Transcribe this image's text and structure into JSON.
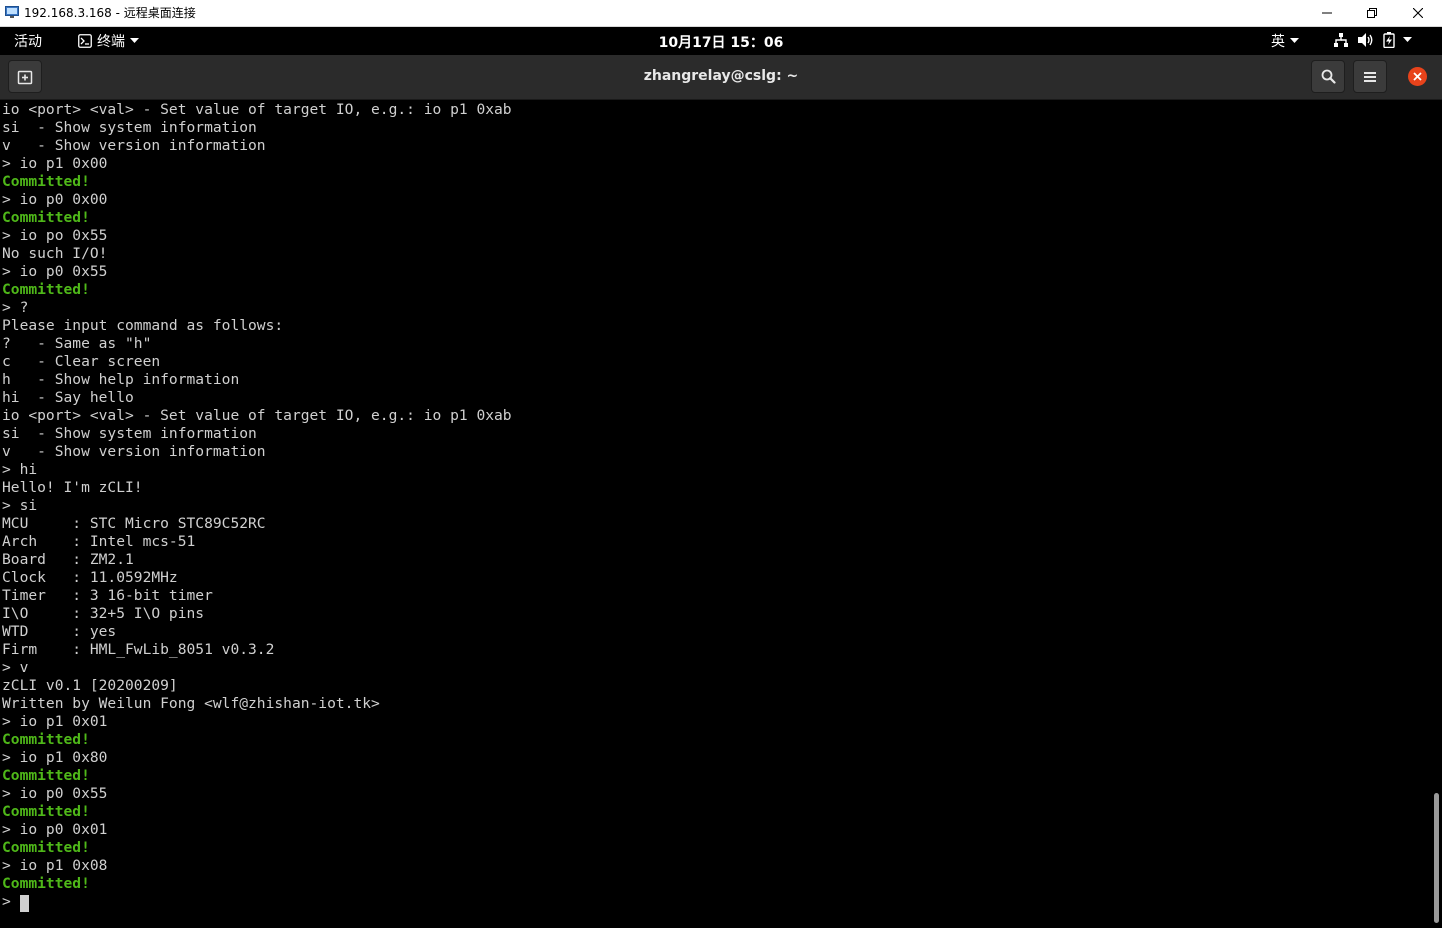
{
  "rdp": {
    "title": "192.168.3.168 - 远程桌面连接"
  },
  "gnome": {
    "activities": "活动",
    "app_name": "终端",
    "clock": "10月17日 15：06",
    "input_method": "英"
  },
  "terminal": {
    "title": "zhangrelay@cslg: ~",
    "prompt": "> ",
    "lines": [
      {
        "text": "io <port> <val> - Set value of target IO, e.g.: io p1 0xab",
        "ok": false
      },
      {
        "text": "si  - Show system information",
        "ok": false
      },
      {
        "text": "v   - Show version information",
        "ok": false
      },
      {
        "text": "> io p1 0x00",
        "ok": false
      },
      {
        "text": "Committed!",
        "ok": true
      },
      {
        "text": "> io p0 0x00",
        "ok": false
      },
      {
        "text": "Committed!",
        "ok": true
      },
      {
        "text": "> io po 0x55",
        "ok": false
      },
      {
        "text": "No such I/O!",
        "ok": false
      },
      {
        "text": "> io p0 0x55",
        "ok": false
      },
      {
        "text": "Committed!",
        "ok": true
      },
      {
        "text": "> ?",
        "ok": false
      },
      {
        "text": "Please input command as follows:",
        "ok": false
      },
      {
        "text": "?   - Same as \"h\"",
        "ok": false
      },
      {
        "text": "c   - Clear screen",
        "ok": false
      },
      {
        "text": "h   - Show help information",
        "ok": false
      },
      {
        "text": "hi  - Say hello",
        "ok": false
      },
      {
        "text": "io <port> <val> - Set value of target IO, e.g.: io p1 0xab",
        "ok": false
      },
      {
        "text": "si  - Show system information",
        "ok": false
      },
      {
        "text": "v   - Show version information",
        "ok": false
      },
      {
        "text": "> hi",
        "ok": false
      },
      {
        "text": "Hello! I'm zCLI!",
        "ok": false
      },
      {
        "text": "> si",
        "ok": false
      },
      {
        "text": "MCU     : STC Micro STC89C52RC",
        "ok": false
      },
      {
        "text": "Arch    : Intel mcs-51",
        "ok": false
      },
      {
        "text": "Board   : ZM2.1",
        "ok": false
      },
      {
        "text": "Clock   : 11.0592MHz",
        "ok": false
      },
      {
        "text": "Timer   : 3 16-bit timer",
        "ok": false
      },
      {
        "text": "I\\O     : 32+5 I\\O pins",
        "ok": false
      },
      {
        "text": "WTD     : yes",
        "ok": false
      },
      {
        "text": "Firm    : HML_FwLib_8051 v0.3.2",
        "ok": false
      },
      {
        "text": "> v",
        "ok": false
      },
      {
        "text": "zCLI v0.1 [20200209]",
        "ok": false
      },
      {
        "text": "Written by Weilun Fong <wlf@zhishan-iot.tk>",
        "ok": false
      },
      {
        "text": "> io p1 0x01",
        "ok": false
      },
      {
        "text": "Committed!",
        "ok": true
      },
      {
        "text": "> io p1 0x80",
        "ok": false
      },
      {
        "text": "Committed!",
        "ok": true
      },
      {
        "text": "> io p0 0x55",
        "ok": false
      },
      {
        "text": "Committed!",
        "ok": true
      },
      {
        "text": "> io p0 0x01",
        "ok": false
      },
      {
        "text": "Committed!",
        "ok": true
      },
      {
        "text": "> io p1 0x08",
        "ok": false
      },
      {
        "text": "Committed!",
        "ok": true
      }
    ]
  },
  "icons": {
    "rdp_app": "remote-desktop-icon",
    "minimize": "minimize-icon",
    "restore": "restore-icon",
    "close": "close-icon",
    "terminal_app": "terminal-icon",
    "network": "network-icon",
    "volume": "volume-icon",
    "battery": "battery-icon",
    "new_tab": "new-tab-icon",
    "search": "search-icon",
    "menu": "hamburger-menu-icon"
  },
  "colors": {
    "committed": "#4fb819",
    "terminal_text": "#d0d0d0",
    "close_button": "#e8431b"
  }
}
